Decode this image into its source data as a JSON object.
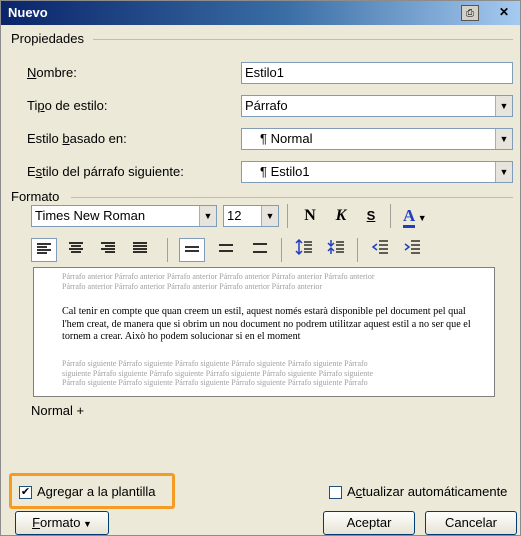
{
  "window": {
    "title": "Nuevo",
    "print_icon": "⎙",
    "close_icon": "✕"
  },
  "properties": {
    "section_label": "Propiedades",
    "name_label_u": "N",
    "name_label_rest": "ombre:",
    "name_value": "Estilo1",
    "type_label_pre": "Ti",
    "type_label_u": "p",
    "type_label_rest": "o de estilo:",
    "type_value": "Párrafo",
    "based_label_pre": "Estilo ",
    "based_label_u": "b",
    "based_label_rest": "asado en:",
    "based_value": "¶ Normal",
    "next_label_pre": "E",
    "next_label_u": "s",
    "next_label_rest": "tilo del párrafo siguiente:",
    "next_value": "¶ Estilo1"
  },
  "format": {
    "section_label": "Formato",
    "font_name": "Times New Roman",
    "font_size": "12",
    "bold": "N",
    "italic": "K",
    "underline": "S",
    "font_color": "A"
  },
  "preview": {
    "prev_lines": [
      "Párrafo anterior Párrafo anterior Párrafo anterior Párrafo anterior Párrafo anterior Párrafo anterior",
      "Párrafo anterior Párrafo anterior Párrafo anterior Párrafo anterior Párrafo anterior"
    ],
    "sample_text": "Cal tenir en compte que quan creem un estil, aquest només estarà disponible pel document pel qual l'hem creat, de manera que si obrim un nou document no podrem utilitzar aquest estil a no ser que el tornem a crear. Això ho podem solucionar si en el moment",
    "next_lines": [
      "Párrafo siguiente Párrafo siguiente Párrafo siguiente Párrafo siguiente Párrafo siguiente Párrafo",
      "siguiente Párrafo siguiente Párrafo siguiente Párrafo siguiente Párrafo siguiente Párrafo siguiente",
      "Párrafo siguiente Párrafo siguiente Párrafo siguiente Párrafo siguiente Párrafo siguiente Párrafo"
    ]
  },
  "description": "Normal +",
  "options": {
    "add_template_pre": "A",
    "add_template_u": "g",
    "add_template_rest": "regar a la plantilla",
    "add_template_checked": true,
    "auto_update_pre": "A",
    "auto_update_u": "c",
    "auto_update_rest": "tualizar automáticamente",
    "auto_update_checked": false
  },
  "buttons": {
    "format_u": "F",
    "format_rest": "ormato",
    "accept": "Aceptar",
    "cancel": "Cancelar"
  },
  "colors": {
    "highlight": "#f59a23",
    "title_bar": "#0a246a",
    "font_color": "#1f3fbf"
  }
}
